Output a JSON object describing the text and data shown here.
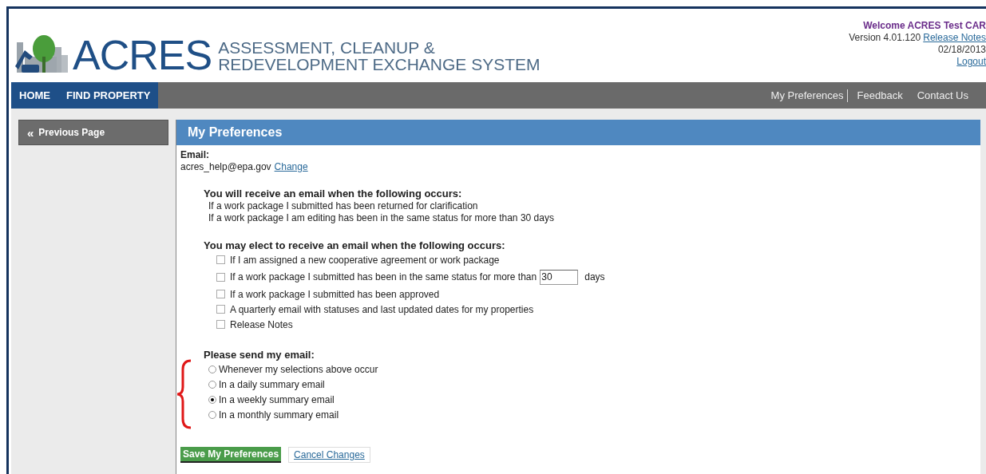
{
  "header": {
    "logo_text": "ACRES",
    "logo_subtitle": [
      "ASSESSMENT, CLEANUP &",
      "REDEVELOPMENT EXCHANGE SYSTEM"
    ],
    "welcome": "Welcome ACRES Test CAR",
    "version": "Version 4.01.120",
    "release_notes_link": "Release Notes",
    "date": "02/18/2013",
    "logout_link": "Logout"
  },
  "nav": {
    "left": [
      {
        "label": "HOME"
      },
      {
        "label": "FIND PROPERTY"
      }
    ],
    "right": [
      {
        "label": "My Preferences",
        "divider": true
      },
      {
        "label": "Feedback",
        "divider": false
      },
      {
        "label": "Contact Us",
        "divider": false
      }
    ]
  },
  "sidebar": {
    "back_button": {
      "icon": "«",
      "label": "Previous Page"
    }
  },
  "panel": {
    "title": "My Preferences",
    "email_label": "Email:",
    "email_value": "acres_help@epa.gov",
    "change_link": "Change",
    "auto_section": {
      "heading": "You will receive an email when the following occurs:",
      "items": [
        "If a work package I submitted has been returned for clarification",
        "If a work package I am editing has been in the same status for more than 30 days"
      ]
    },
    "elect_section": {
      "heading": "You may elect to receive an email when the following occurs:",
      "items": [
        {
          "kind": "checkbox",
          "label": "If I am assigned a new cooperative agreement or work package",
          "checked": false
        },
        {
          "kind": "checkbox_days",
          "label": "If a work package I submitted has been in the same status for more than",
          "value": "30",
          "suffix": "days",
          "checked": false
        },
        {
          "kind": "checkbox",
          "label": "If a work package I submitted has been approved",
          "checked": false
        },
        {
          "kind": "checkbox",
          "label": "A quarterly email with statuses and last updated dates for my properties",
          "checked": false
        },
        {
          "kind": "checkbox",
          "label": "Release Notes",
          "checked": false
        }
      ]
    },
    "send_section": {
      "heading": "Please send my email:",
      "options": [
        {
          "label": "Whenever my selections above occur",
          "selected": false
        },
        {
          "label": "In a daily summary email",
          "selected": false
        },
        {
          "label": "In a weekly summary email",
          "selected": true
        },
        {
          "label": "In a monthly summary email",
          "selected": false
        }
      ]
    },
    "save_button": "Save My Preferences",
    "cancel_button": "Cancel Changes"
  }
}
